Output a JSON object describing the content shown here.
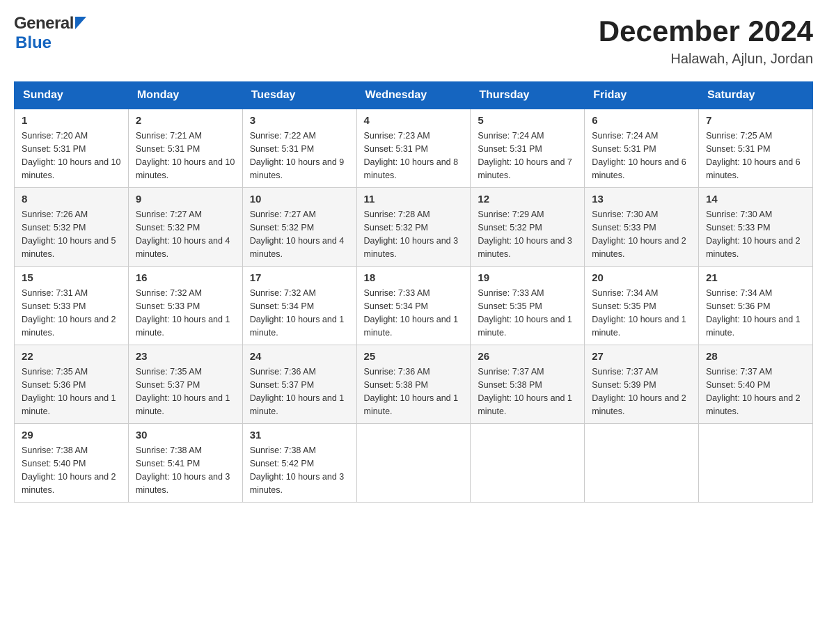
{
  "header": {
    "title": "December 2024",
    "subtitle": "Halawah, Ajlun, Jordan",
    "logo_general": "General",
    "logo_blue": "Blue"
  },
  "days_of_week": [
    "Sunday",
    "Monday",
    "Tuesday",
    "Wednesday",
    "Thursday",
    "Friday",
    "Saturday"
  ],
  "weeks": [
    [
      {
        "day": "1",
        "sunrise": "7:20 AM",
        "sunset": "5:31 PM",
        "daylight": "10 hours and 10 minutes."
      },
      {
        "day": "2",
        "sunrise": "7:21 AM",
        "sunset": "5:31 PM",
        "daylight": "10 hours and 10 minutes."
      },
      {
        "day": "3",
        "sunrise": "7:22 AM",
        "sunset": "5:31 PM",
        "daylight": "10 hours and 9 minutes."
      },
      {
        "day": "4",
        "sunrise": "7:23 AM",
        "sunset": "5:31 PM",
        "daylight": "10 hours and 8 minutes."
      },
      {
        "day": "5",
        "sunrise": "7:24 AM",
        "sunset": "5:31 PM",
        "daylight": "10 hours and 7 minutes."
      },
      {
        "day": "6",
        "sunrise": "7:24 AM",
        "sunset": "5:31 PM",
        "daylight": "10 hours and 6 minutes."
      },
      {
        "day": "7",
        "sunrise": "7:25 AM",
        "sunset": "5:31 PM",
        "daylight": "10 hours and 6 minutes."
      }
    ],
    [
      {
        "day": "8",
        "sunrise": "7:26 AM",
        "sunset": "5:32 PM",
        "daylight": "10 hours and 5 minutes."
      },
      {
        "day": "9",
        "sunrise": "7:27 AM",
        "sunset": "5:32 PM",
        "daylight": "10 hours and 4 minutes."
      },
      {
        "day": "10",
        "sunrise": "7:27 AM",
        "sunset": "5:32 PM",
        "daylight": "10 hours and 4 minutes."
      },
      {
        "day": "11",
        "sunrise": "7:28 AM",
        "sunset": "5:32 PM",
        "daylight": "10 hours and 3 minutes."
      },
      {
        "day": "12",
        "sunrise": "7:29 AM",
        "sunset": "5:32 PM",
        "daylight": "10 hours and 3 minutes."
      },
      {
        "day": "13",
        "sunrise": "7:30 AM",
        "sunset": "5:33 PM",
        "daylight": "10 hours and 2 minutes."
      },
      {
        "day": "14",
        "sunrise": "7:30 AM",
        "sunset": "5:33 PM",
        "daylight": "10 hours and 2 minutes."
      }
    ],
    [
      {
        "day": "15",
        "sunrise": "7:31 AM",
        "sunset": "5:33 PM",
        "daylight": "10 hours and 2 minutes."
      },
      {
        "day": "16",
        "sunrise": "7:32 AM",
        "sunset": "5:33 PM",
        "daylight": "10 hours and 1 minute."
      },
      {
        "day": "17",
        "sunrise": "7:32 AM",
        "sunset": "5:34 PM",
        "daylight": "10 hours and 1 minute."
      },
      {
        "day": "18",
        "sunrise": "7:33 AM",
        "sunset": "5:34 PM",
        "daylight": "10 hours and 1 minute."
      },
      {
        "day": "19",
        "sunrise": "7:33 AM",
        "sunset": "5:35 PM",
        "daylight": "10 hours and 1 minute."
      },
      {
        "day": "20",
        "sunrise": "7:34 AM",
        "sunset": "5:35 PM",
        "daylight": "10 hours and 1 minute."
      },
      {
        "day": "21",
        "sunrise": "7:34 AM",
        "sunset": "5:36 PM",
        "daylight": "10 hours and 1 minute."
      }
    ],
    [
      {
        "day": "22",
        "sunrise": "7:35 AM",
        "sunset": "5:36 PM",
        "daylight": "10 hours and 1 minute."
      },
      {
        "day": "23",
        "sunrise": "7:35 AM",
        "sunset": "5:37 PM",
        "daylight": "10 hours and 1 minute."
      },
      {
        "day": "24",
        "sunrise": "7:36 AM",
        "sunset": "5:37 PM",
        "daylight": "10 hours and 1 minute."
      },
      {
        "day": "25",
        "sunrise": "7:36 AM",
        "sunset": "5:38 PM",
        "daylight": "10 hours and 1 minute."
      },
      {
        "day": "26",
        "sunrise": "7:37 AM",
        "sunset": "5:38 PM",
        "daylight": "10 hours and 1 minute."
      },
      {
        "day": "27",
        "sunrise": "7:37 AM",
        "sunset": "5:39 PM",
        "daylight": "10 hours and 2 minutes."
      },
      {
        "day": "28",
        "sunrise": "7:37 AM",
        "sunset": "5:40 PM",
        "daylight": "10 hours and 2 minutes."
      }
    ],
    [
      {
        "day": "29",
        "sunrise": "7:38 AM",
        "sunset": "5:40 PM",
        "daylight": "10 hours and 2 minutes."
      },
      {
        "day": "30",
        "sunrise": "7:38 AM",
        "sunset": "5:41 PM",
        "daylight": "10 hours and 3 minutes."
      },
      {
        "day": "31",
        "sunrise": "7:38 AM",
        "sunset": "5:42 PM",
        "daylight": "10 hours and 3 minutes."
      },
      null,
      null,
      null,
      null
    ]
  ]
}
